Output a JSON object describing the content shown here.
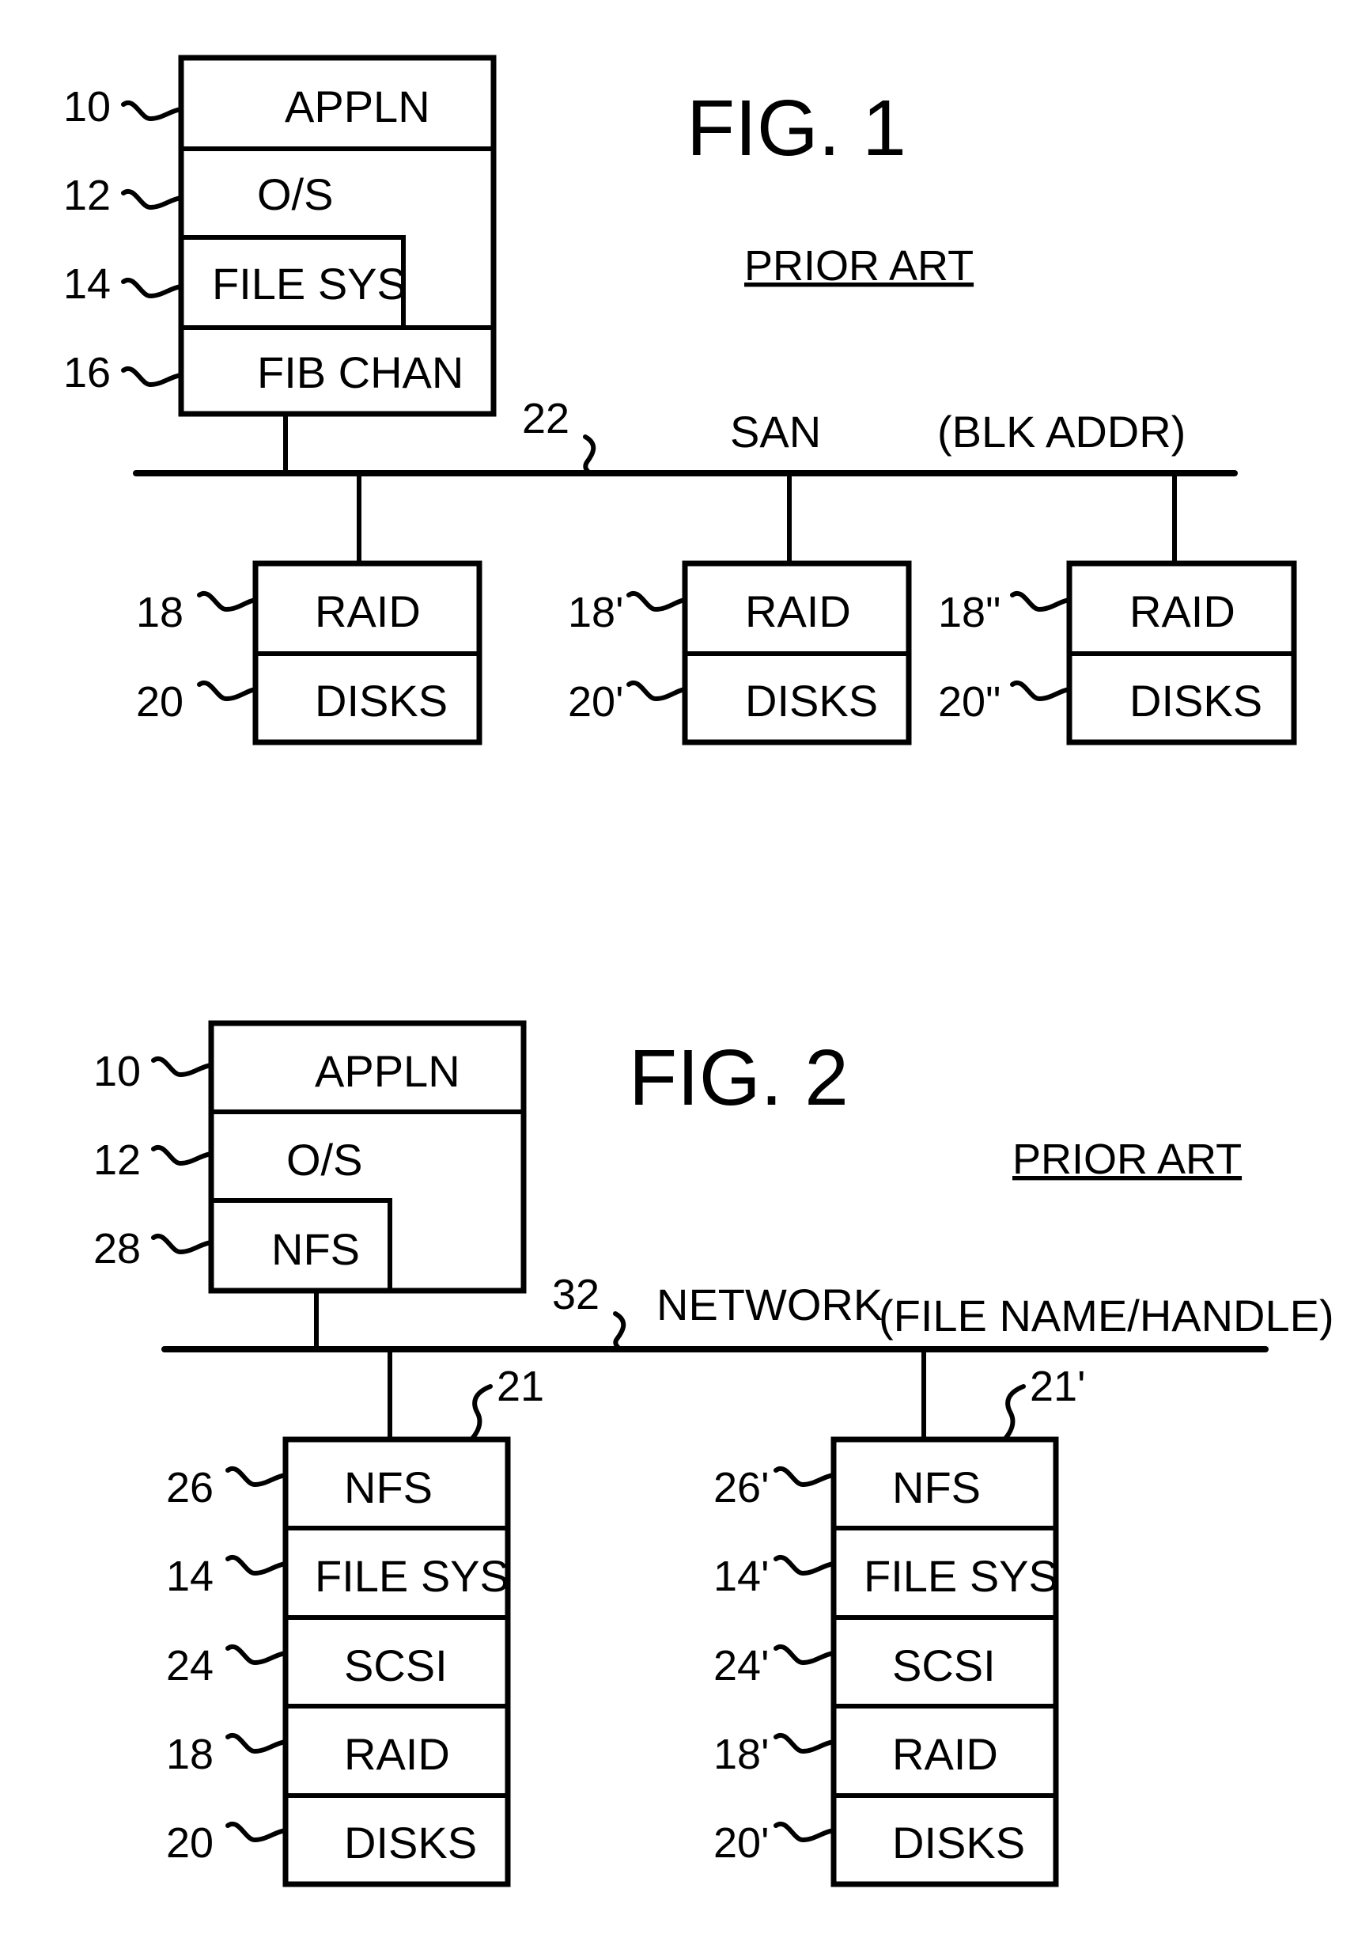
{
  "fig1": {
    "title": "FIG. 1",
    "subtitle": "PRIOR ART",
    "host_stack": {
      "layers": [
        {
          "ref": "10",
          "label": "APPLN"
        },
        {
          "ref": "12",
          "label": "O/S"
        },
        {
          "ref": "14",
          "label": "FILE SYS"
        },
        {
          "ref": "16",
          "label": "FIB CHAN"
        }
      ]
    },
    "bus": {
      "ref": "22",
      "label": "SAN",
      "note": "(BLK ADDR)"
    },
    "storage": [
      {
        "raid_ref": "18",
        "raid_label": "RAID",
        "disks_ref": "20",
        "disks_label": "DISKS"
      },
      {
        "raid_ref": "18'",
        "raid_label": "RAID",
        "disks_ref": "20'",
        "disks_label": "DISKS"
      },
      {
        "raid_ref": "18\"",
        "raid_label": "RAID",
        "disks_ref": "20\"",
        "disks_label": "DISKS"
      }
    ]
  },
  "fig2": {
    "title": "FIG. 2",
    "subtitle": "PRIOR ART",
    "host_stack": {
      "layers": [
        {
          "ref": "10",
          "label": "APPLN"
        },
        {
          "ref": "12",
          "label": "O/S"
        },
        {
          "ref": "28",
          "label": "NFS"
        }
      ]
    },
    "bus": {
      "ref": "32",
      "label": "NETWORK",
      "note": "(FILE NAME/HANDLE)"
    },
    "servers": [
      {
        "ref": "21",
        "layers": [
          {
            "ref": "26",
            "label": "NFS"
          },
          {
            "ref": "14",
            "label": "FILE SYS"
          },
          {
            "ref": "24",
            "label": "SCSI"
          },
          {
            "ref": "18",
            "label": "RAID"
          },
          {
            "ref": "20",
            "label": "DISKS"
          }
        ]
      },
      {
        "ref": "21'",
        "layers": [
          {
            "ref": "26'",
            "label": "NFS"
          },
          {
            "ref": "14'",
            "label": "FILE SYS"
          },
          {
            "ref": "24'",
            "label": "SCSI"
          },
          {
            "ref": "18'",
            "label": "RAID"
          },
          {
            "ref": "20'",
            "label": "DISKS"
          }
        ]
      }
    ]
  }
}
